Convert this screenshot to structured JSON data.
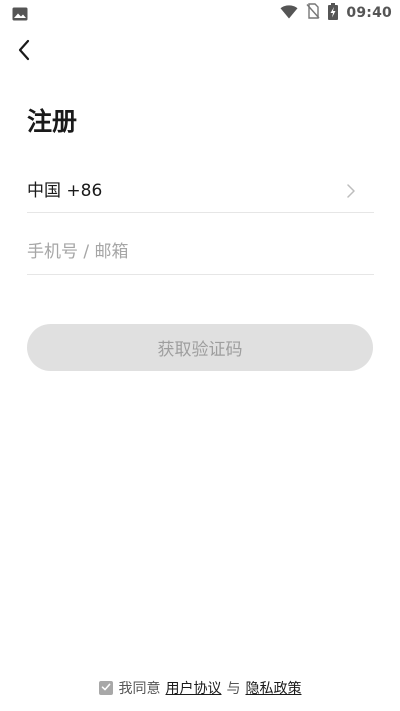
{
  "status_bar": {
    "time": "09:40",
    "left_icon": "image-notification-icon",
    "right_icons": [
      "wifi-icon",
      "no-sim-icon",
      "battery-charging-icon"
    ]
  },
  "nav": {
    "back_icon": "chevron-left-icon"
  },
  "page": {
    "title": "注册"
  },
  "form": {
    "country_label": "中国 +86",
    "country_icon": "chevron-right-icon",
    "phone_placeholder": "手机号 / 邮箱",
    "phone_value": "",
    "submit_label": "获取验证码"
  },
  "agreement": {
    "checked": true,
    "prefix": "我同意",
    "user_agreement": "用户协议",
    "connector": "与",
    "privacy_policy": "隐私政策"
  },
  "colors": {
    "button_disabled_bg": "#e0e0e0",
    "button_disabled_text": "#9e9e9e",
    "divider": "#e6e6e6",
    "checkbox": "#a8a8a8"
  }
}
